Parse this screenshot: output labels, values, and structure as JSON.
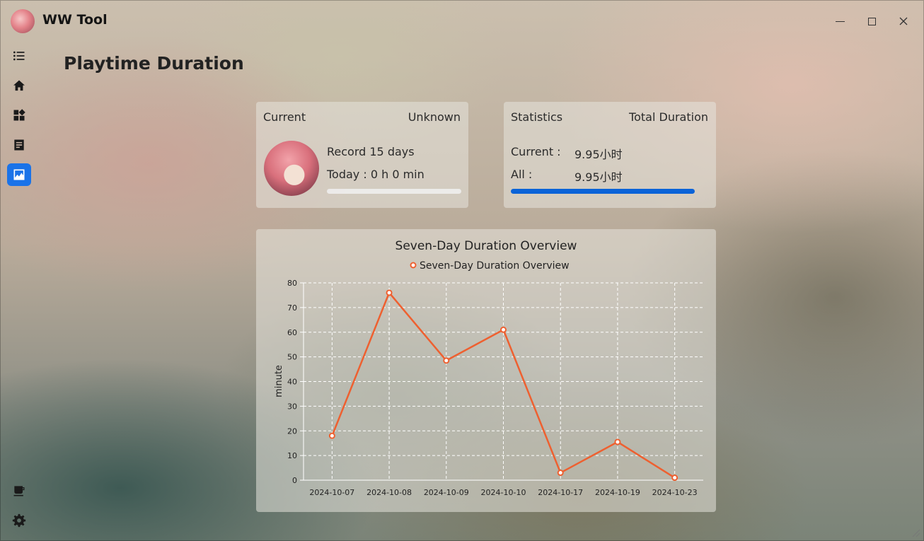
{
  "window": {
    "title": "WW Tool"
  },
  "nav": {
    "items": [
      {
        "name": "menu-icon"
      },
      {
        "name": "home-icon"
      },
      {
        "name": "widgets-icon"
      },
      {
        "name": "notes-icon"
      },
      {
        "name": "chart-image-icon",
        "active": true
      }
    ],
    "bottom": [
      {
        "name": "coffee-icon"
      },
      {
        "name": "settings-gear-icon"
      }
    ]
  },
  "page": {
    "title": "Playtime Duration"
  },
  "current_card": {
    "header_left": "Current",
    "header_right": "Unknown",
    "record": "Record 15 days",
    "today": "Today : 0 h 0 min",
    "progress_fraction": 0
  },
  "stats_card": {
    "header_left": "Statistics",
    "header_right": "Total Duration",
    "current_label": "Current :",
    "current_value": "9.95小时",
    "all_label": "All :",
    "all_value": "9.95小时",
    "progress_fraction": 1
  },
  "colors": {
    "accent": "#1a73e8",
    "line": "#ee6030",
    "progress": "#0a63d8"
  },
  "chart_data": {
    "type": "line",
    "title": "Seven-Day Duration Overview",
    "ylabel": "minute",
    "xlabel": "",
    "categories": [
      "2024-10-07",
      "2024-10-08",
      "2024-10-09",
      "2024-10-10",
      "2024-10-17",
      "2024-10-19",
      "2024-10-23"
    ],
    "series": [
      {
        "name": "Seven-Day Duration Overview",
        "values": [
          18,
          76,
          48.5,
          61,
          3,
          15.5,
          1
        ]
      }
    ],
    "ylim": [
      0,
      80
    ],
    "yticks": [
      0,
      10,
      20,
      30,
      40,
      50,
      60,
      70,
      80
    ],
    "grid": true,
    "legend": "top-center"
  }
}
